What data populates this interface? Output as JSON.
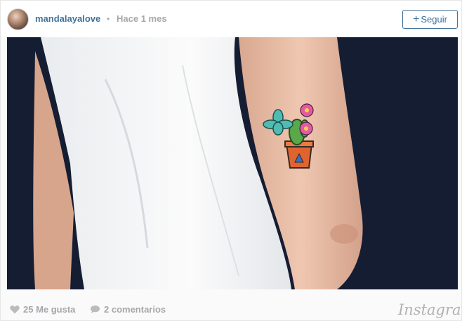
{
  "post": {
    "username": "mandalayalove",
    "separator": "•",
    "timestamp": "Hace 1 mes",
    "follow_label": "Seguir"
  },
  "stats": {
    "likes": "25 Me gusta",
    "comments": "2 comentarios"
  },
  "brand": {
    "wordmark": "Instagram"
  },
  "icons": {
    "follow": "plus-icon",
    "likes": "heart-icon",
    "comments": "comment-bubble-icon"
  },
  "colors": {
    "link_blue": "#3f729b",
    "muted_gray": "#a5a7aa",
    "photo_background": "#141f36"
  }
}
